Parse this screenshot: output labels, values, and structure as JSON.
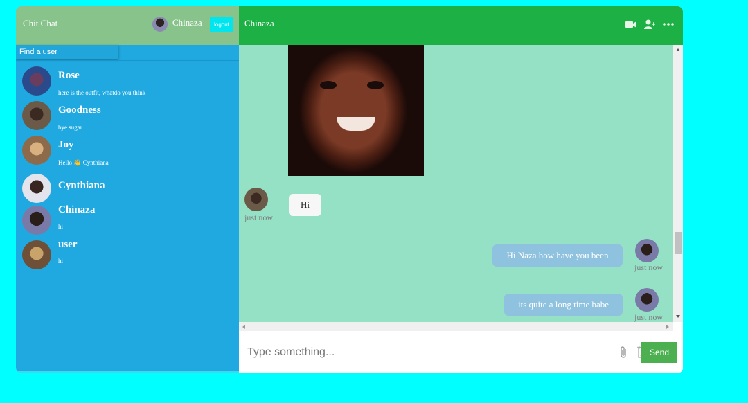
{
  "sidebar": {
    "app_title": "Chit Chat",
    "current_user": "Chinaza",
    "logout_label": "logout",
    "search_placeholder": "Find a user",
    "users": [
      {
        "name": "Rose",
        "last_message": "here is the outfit, whatdo you think",
        "avatar_color": "#2b4a8c"
      },
      {
        "name": "Goodness",
        "last_message": "bye sugar",
        "avatar_color": "#5b4a3a"
      },
      {
        "name": "Joy",
        "last_message": "Hello 👋 Cynthiana",
        "avatar_color": "#b08a5a"
      },
      {
        "name": "Cynthiana",
        "last_message": "",
        "avatar_color": "#d8d8e0"
      },
      {
        "name": "Chinaza",
        "last_message": "hi",
        "avatar_color": "#7a7aa8"
      },
      {
        "name": "user",
        "last_message": "hi",
        "avatar_color": "#8a6a48"
      }
    ]
  },
  "chat": {
    "title": "Chinaza",
    "header_icons": [
      "video-camera-icon",
      "add-user-icon",
      "more-options-icon"
    ],
    "messages": [
      {
        "direction": "incoming",
        "type": "image"
      },
      {
        "direction": "incoming",
        "text": "Hi",
        "time": "just now"
      },
      {
        "direction": "outgoing",
        "text": "Hi Naza how have you been",
        "time": "just now"
      },
      {
        "direction": "outgoing",
        "text": "its quite a long time babe",
        "time": "just now"
      }
    ],
    "composer": {
      "placeholder": "Type something...",
      "send_label": "Send",
      "icons": [
        "attach-icon",
        "image-upload-icon"
      ]
    }
  },
  "colors": {
    "page_bg": "#00ffff",
    "sidebar_bg": "#1fa9e0",
    "sidebar_header_bg": "#88c38b",
    "chat_header_bg": "#1db045",
    "messages_bg": "#95e1c6",
    "outgoing_bubble": "#8ec2df",
    "send_button": "#4caf50"
  }
}
